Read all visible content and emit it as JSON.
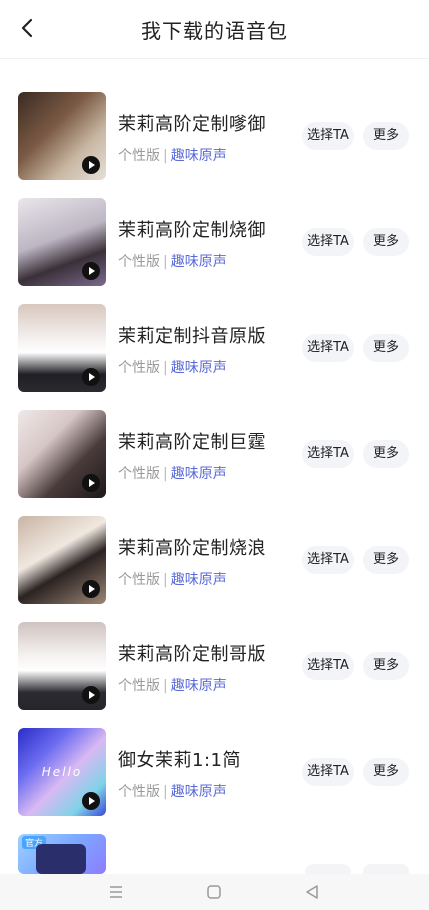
{
  "header": {
    "title": "我下载的语音包",
    "back_icon": "chevron-left-icon"
  },
  "items": [
    {
      "title": "茉莉高阶定制嗲御",
      "type": "个性版",
      "sep": "|",
      "source": "趣味原声",
      "select_label": "选择TA",
      "more_label": "更多"
    },
    {
      "title": "茉莉高阶定制烧御",
      "type": "个性版",
      "sep": "|",
      "source": "趣味原声",
      "select_label": "选择TA",
      "more_label": "更多"
    },
    {
      "title": "茉莉定制抖音原版",
      "type": "个性版",
      "sep": "|",
      "source": "趣味原声",
      "select_label": "选择TA",
      "more_label": "更多"
    },
    {
      "title": "茉莉高阶定制巨霆",
      "type": "个性版",
      "sep": "|",
      "source": "趣味原声",
      "select_label": "选择TA",
      "more_label": "更多"
    },
    {
      "title": "茉莉高阶定制烧浪",
      "type": "个性版",
      "sep": "|",
      "source": "趣味原声",
      "select_label": "选择TA",
      "more_label": "更多"
    },
    {
      "title": "茉莉高阶定制哥版",
      "type": "个性版",
      "sep": "|",
      "source": "趣味原声",
      "select_label": "选择TA",
      "more_label": "更多"
    },
    {
      "title": "御女茉莉1:1简",
      "type": "个性版",
      "sep": "|",
      "source": "趣味原声",
      "select_label": "选择TA",
      "more_label": "更多",
      "thumb_text": "Hello"
    }
  ],
  "partial_item": {
    "badge": "官方"
  },
  "navbar": {
    "menu_icon": "menu-icon",
    "home_icon": "square-home-icon",
    "back_icon": "triangle-back-icon"
  },
  "colors": {
    "accent": "#5b6bd6",
    "button_bg": "#f3f4f7",
    "meta_gray": "#9a9a9a"
  }
}
